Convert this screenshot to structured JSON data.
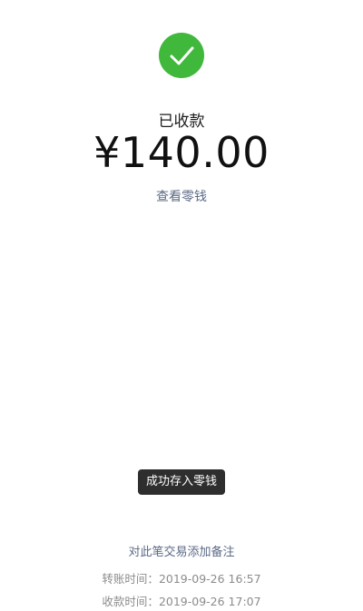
{
  "status": {
    "icon": "check-circle-icon",
    "label": "已收款"
  },
  "amount": "¥140.00",
  "links": {
    "view_change": "查看零钱",
    "add_note": "对此笔交易添加备注"
  },
  "toast": "成功存入零钱",
  "details": {
    "transfer_time_label": "转账时间：",
    "transfer_time_value": "2019-09-26 16:57",
    "receive_time_label": "收款时间：",
    "receive_time_value": "2019-09-26 17:07"
  },
  "colors": {
    "success_green": "#3fb83c",
    "link_blue": "#5b6a86",
    "toast_bg": "#2e2e2e",
    "muted_text": "#8c8c8c"
  }
}
